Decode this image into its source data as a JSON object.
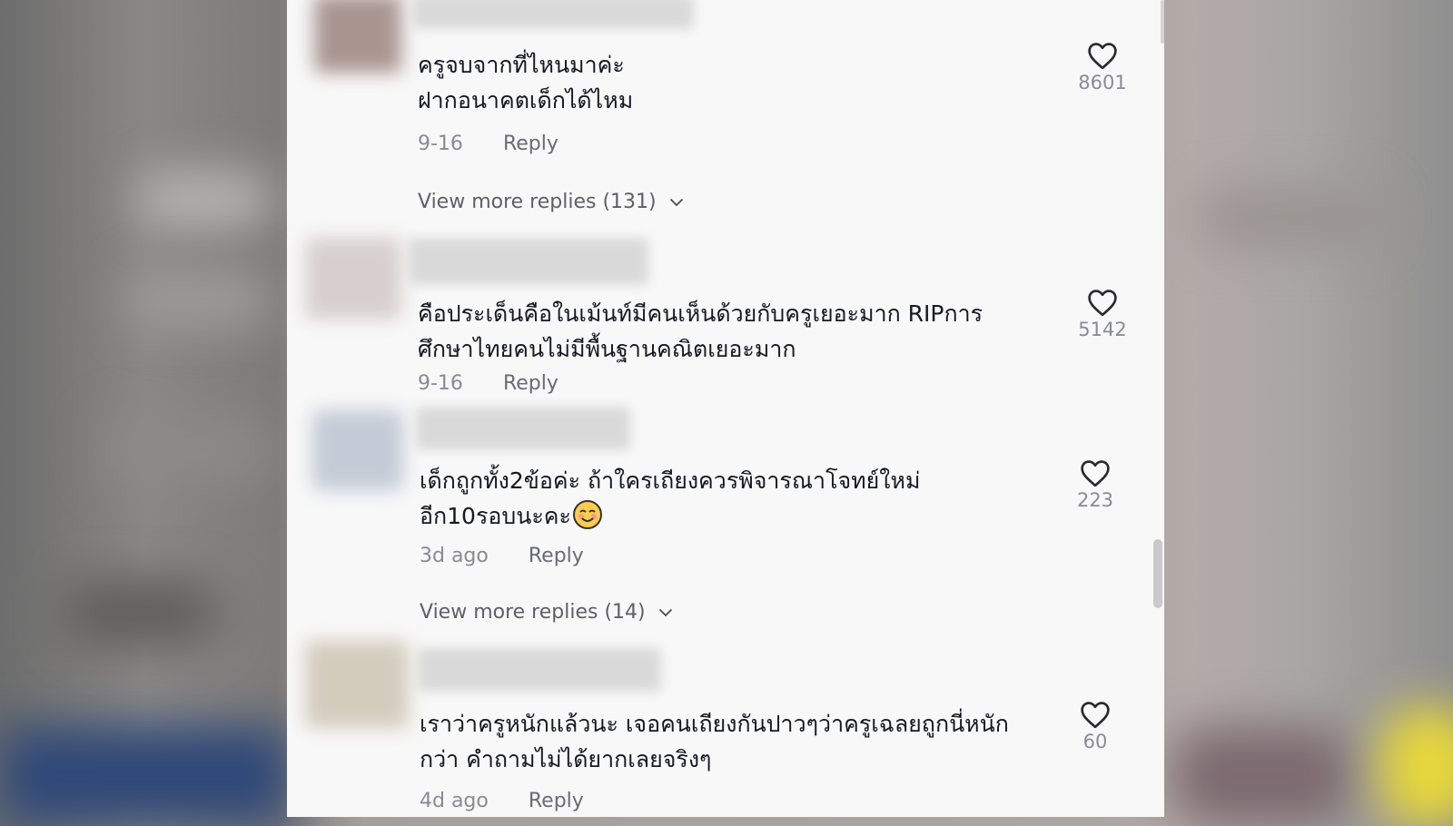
{
  "comments": [
    {
      "text": "ครูจบจากที่ไหนมาค่ะ\nฝากอนาคตเด็กได้ไหม",
      "date": "9-16",
      "reply_label": "Reply",
      "likes": "8601",
      "more_replies": "View more replies (131)"
    },
    {
      "text": "คือประเด็นคือในเม้นท์มีคนเห็นด้วยกับครูเยอะมาก RIPการ\nศึกษาไทยคนไม่มีพื้นฐานคณิตเยอะมาก",
      "date": "9-16",
      "reply_label": "Reply",
      "likes": "5142"
    },
    {
      "text": "เด็กถูกทั้ง2ข้อค่ะ ถ้าใครเถียงควรพิจารณาโจทย์ใหม่\nอีก10รอบนะคะ",
      "emoji": "smiling-face-emoji",
      "date": "3d ago",
      "reply_label": "Reply",
      "likes": "223",
      "more_replies": "View more replies (14)"
    },
    {
      "text": "เราว่าครูหนักแล้วนะ เจอคนเถียงกันปาวๆว่าครูเฉลยถูกนี่หนัก\nกว่า คำถามไม่ได้ยากเลยจริงๆ",
      "date": "4d ago",
      "reply_label": "Reply",
      "likes": "60"
    }
  ],
  "icons": {
    "like": "heart-outline-icon",
    "expand": "chevron-down-icon"
  },
  "colors": {
    "panel_bg": "#f8f8f8",
    "text": "#161823",
    "meta": "#8a8b91"
  }
}
